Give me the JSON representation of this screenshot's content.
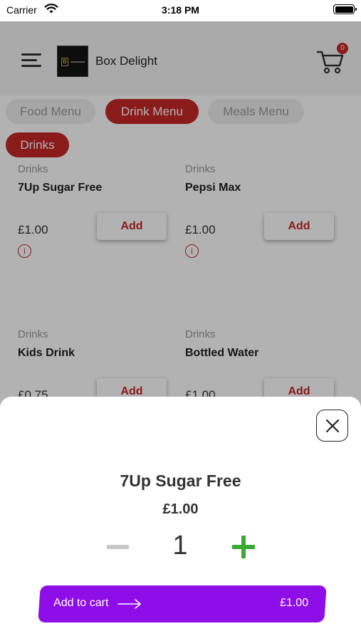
{
  "status_bar": {
    "carrier": "Carrier",
    "time": "3:18 PM"
  },
  "header": {
    "brand": "Box Delight",
    "cart_count": "0"
  },
  "tabs": [
    {
      "label": "Food Menu",
      "active": false
    },
    {
      "label": "Drink Menu",
      "active": true
    },
    {
      "label": "Meals Menu",
      "active": false
    }
  ],
  "subcategory": "Drinks",
  "products": [
    {
      "category": "Drinks",
      "name": "7Up Sugar Free",
      "price": "£1.00",
      "add_label": "Add",
      "info_icon": "i"
    },
    {
      "category": "Drinks",
      "name": "Pepsi Max",
      "price": "£1.00",
      "add_label": "Add",
      "info_icon": "i"
    },
    {
      "category": "Drinks",
      "name": "Kids Drink",
      "price": "£0.75",
      "add_label": "Add"
    },
    {
      "category": "Drinks",
      "name": "Bottled Water",
      "price": "£1.00",
      "add_label": "Add"
    }
  ],
  "sheet": {
    "title": "7Up Sugar Free",
    "price": "£1.00",
    "quantity": "1",
    "add_to_cart_label": "Add to cart",
    "total": "£1.00"
  },
  "colors": {
    "accent_red": "#c62828",
    "purple_button": "#8e0ee8",
    "plus_green": "#3aaa35",
    "minus_grey": "#c8c8c8"
  },
  "icons": [
    "wifi-icon",
    "battery-icon",
    "menu-icon",
    "cart-icon",
    "info-icon",
    "close-icon",
    "arrow-right-icon",
    "minus-icon",
    "plus-icon"
  ]
}
